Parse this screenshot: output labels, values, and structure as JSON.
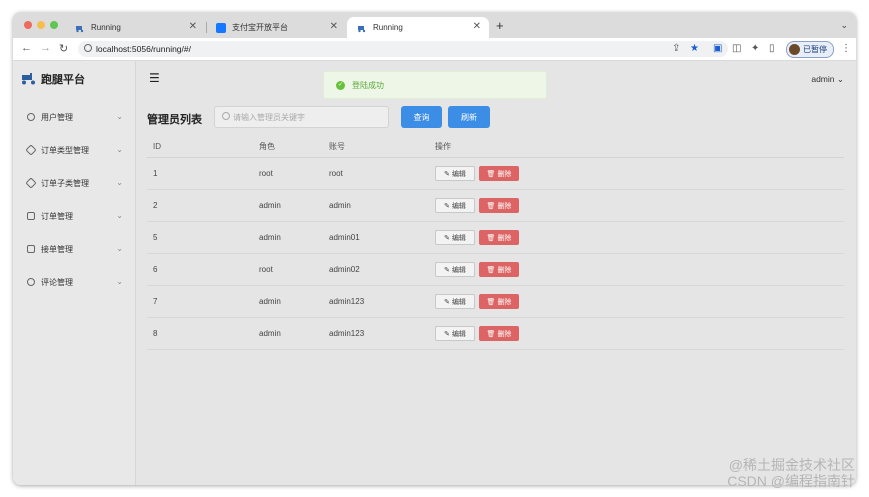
{
  "browser": {
    "tabs": [
      {
        "title": "Running",
        "active": false
      },
      {
        "title": "支付宝开放平台",
        "active": false
      },
      {
        "title": "Running",
        "active": true
      }
    ],
    "new_tab_label": "+",
    "url": "localhost:5056/running/#/",
    "profile_label": "已暂停"
  },
  "app": {
    "logo_text": "跑腿平台",
    "user_menu": "admin",
    "toast": "登陆成功",
    "sidebar": [
      {
        "label": "用户管理"
      },
      {
        "label": "订单类型管理"
      },
      {
        "label": "订单子类管理"
      },
      {
        "label": "订单管理"
      },
      {
        "label": "接单管理"
      },
      {
        "label": "评论管理"
      }
    ],
    "list": {
      "title": "管理员列表",
      "search_placeholder": "请输入管理员关键字",
      "query_label": "查询",
      "refresh_label": "刷新",
      "columns": [
        "ID",
        "角色",
        "账号",
        "操作"
      ],
      "edit_label": "编辑",
      "delete_label": "删除",
      "rows": [
        {
          "id": "1",
          "role": "root",
          "account": "root"
        },
        {
          "id": "2",
          "role": "admin",
          "account": "admin"
        },
        {
          "id": "5",
          "role": "admin",
          "account": "admin01"
        },
        {
          "id": "6",
          "role": "root",
          "account": "admin02"
        },
        {
          "id": "7",
          "role": "admin",
          "account": "admin123"
        },
        {
          "id": "8",
          "role": "admin",
          "account": "admin123"
        }
      ]
    }
  },
  "watermark": {
    "line1": "@稀土掘金技术社区",
    "line2": "CSDN @编程指南针"
  },
  "colors": {
    "primary": "#3b8de5",
    "danger": "#dc6464",
    "success": "#67c23a",
    "close_dot": "#ed6a5e",
    "minimize_dot": "#f5bf4f",
    "zoom_dot": "#61c554"
  }
}
